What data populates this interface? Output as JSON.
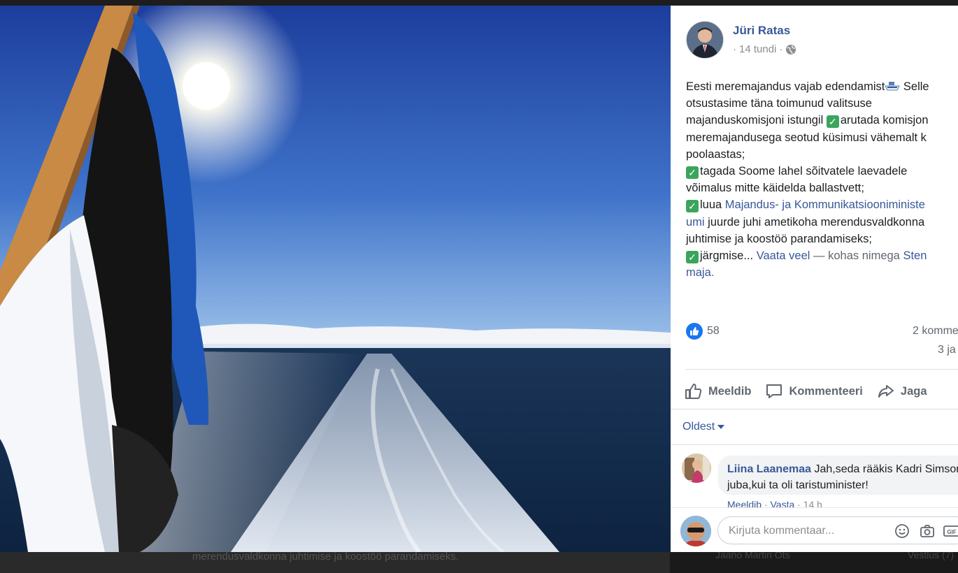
{
  "post": {
    "author": "Jüri Ratas",
    "time": "14 tundi",
    "text_intro": "Eesti meremajandus vajab edendamist",
    "text_1": " Selle",
    "text_2": "otsustasime täna toimunud valitsuse",
    "text_3": "majanduskomisjoni istungil ",
    "text_3b": "arutada komisjon",
    "text_4": "meremajandusega seotud küsimusi vähemalt k",
    "text_5": "poolaastas;",
    "text_6": "tagada Soome lahel sõitvatele laevadele",
    "text_7": "võimalus mitte käidelda ballastvett;",
    "text_8a": "luua ",
    "text_8link": "Majandus- ja Kommunikatsiooniministe",
    "text_9link": "umi",
    "text_9": " juurde juhi ametikoha merendusvaldkonna",
    "text_10": "juhtimise ja koostöö parandamiseks;",
    "text_11": "järgmise...",
    "see_more": "Vaata veel",
    "place_prefix": " — kohas nimega ",
    "place_1": "Sten",
    "place_2": "maja",
    "place_suffix": "."
  },
  "stats": {
    "likes": "58",
    "comments": "2 komme",
    "shares": "3 ja"
  },
  "actions": {
    "like": "Meeldib",
    "comment": "Kommenteeri",
    "share": "Jaga"
  },
  "sort": {
    "label": "Oldest"
  },
  "comment": {
    "name": "Liina Laanemaa",
    "text": "Jah,seda rääkis Kadri Simson juba,kui ta oli taristuminister!",
    "like": "Meeldib",
    "reply": "Vasta",
    "time": "14 h"
  },
  "composer": {
    "placeholder": "Kirjuta kommentaar..."
  },
  "background": {
    "text_1": "merendusvaldkonna juhtimise ja koostöö parandamiseks.",
    "chat_name": "Jaano Martin Ots",
    "chat_label": "Vestlus (7)"
  },
  "colors": {
    "link": "#385898",
    "like_blue": "#1877f2",
    "check_green": "#3ba55c"
  }
}
